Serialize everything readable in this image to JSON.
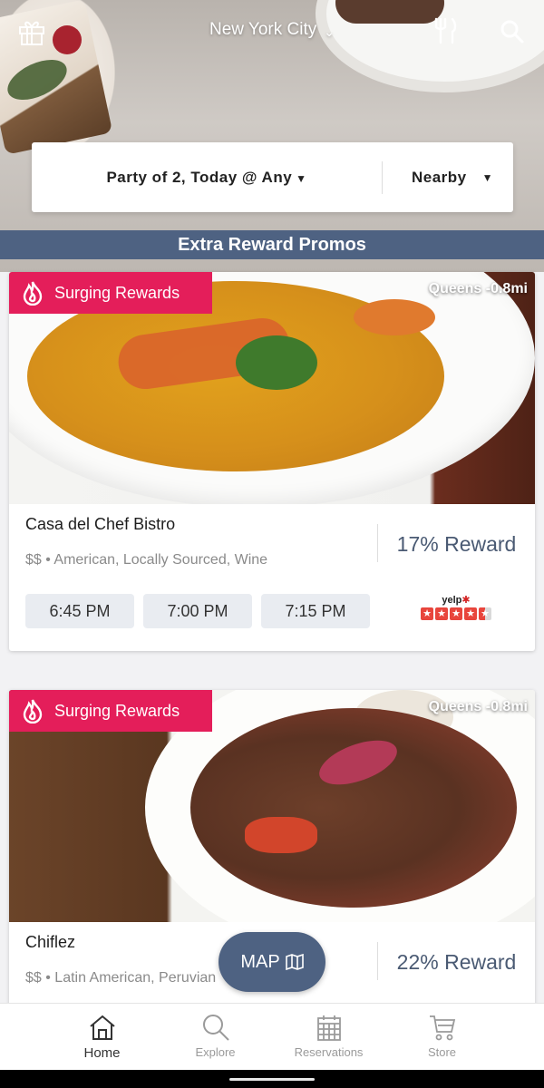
{
  "header": {
    "location": "New York City"
  },
  "filters": {
    "party": "Party of 2, Today @ Any",
    "distance": "Nearby"
  },
  "banner": "Extra Reward Promos",
  "restaurants": [
    {
      "badge": "Surging Rewards",
      "distance": "Queens -0.8mi",
      "name": "Casa del Chef Bistro",
      "price": "$$",
      "cuisine": "American, Locally Sourced, Wine",
      "reward": "17% Reward",
      "slots": [
        "6:45 PM",
        "7:00 PM",
        "7:15 PM"
      ],
      "rating_provider": "yelp",
      "rating": 4.5
    },
    {
      "badge": "Surging Rewards",
      "distance": "Queens -0.8mi",
      "name": "Chiflez",
      "price": "$$",
      "cuisine": "Latin American, Peruvian",
      "reward": "22% Reward"
    }
  ],
  "map_button": "MAP",
  "tabs": [
    {
      "label": "Home",
      "icon": "home-icon",
      "active": true
    },
    {
      "label": "Explore",
      "icon": "search-icon",
      "active": false
    },
    {
      "label": "Reservations",
      "icon": "calendar-icon",
      "active": false
    },
    {
      "label": "Store",
      "icon": "cart-icon",
      "active": false
    }
  ],
  "colors": {
    "accent": "#4e6282",
    "badge": "#e41e5a",
    "yelp": "#e8453c"
  }
}
